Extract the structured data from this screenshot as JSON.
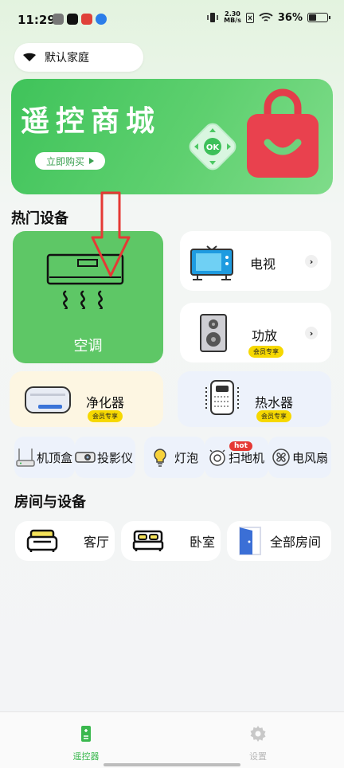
{
  "status_bar": {
    "time": "11:29",
    "net_speed_value": "2.30",
    "net_speed_unit": "MB/s",
    "battery": "36%"
  },
  "home_selector": {
    "label": "默认家庭"
  },
  "banner": {
    "title": "遥控商城",
    "buy_label": "立即购买",
    "ok_label": "OK",
    "accent": "#4cc863"
  },
  "hot_devices": {
    "title": "热门设备",
    "ac": {
      "label": "空调"
    },
    "tv": {
      "label": "电视"
    },
    "amp": {
      "label": "功放",
      "badge": "会员专享"
    },
    "purifier": {
      "label": "净化器",
      "badge": "会员专享"
    },
    "heater": {
      "label": "热水器",
      "badge": "会员专享"
    }
  },
  "mini_devices": [
    {
      "label": "机顶盒"
    },
    {
      "label": "投影仪"
    },
    {
      "label": "灯泡"
    },
    {
      "label": "扫地机",
      "badge": "hot"
    },
    {
      "label": "电风扇"
    }
  ],
  "rooms": {
    "title": "房间与设备",
    "items": [
      {
        "label": "客厅",
        "icon": "sofa-icon"
      },
      {
        "label": "卧室",
        "icon": "bed-icon"
      },
      {
        "label": "全部房间",
        "icon": "door-icon"
      }
    ]
  },
  "bottom_nav": {
    "remote_label": "遥控器",
    "settings_label": "设置",
    "active_color": "#3ab84e"
  }
}
